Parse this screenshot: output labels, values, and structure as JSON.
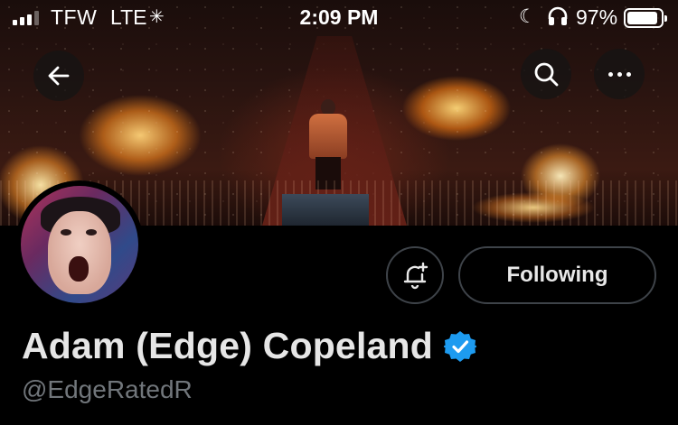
{
  "status_bar": {
    "carrier": "TFW",
    "network": "LTE",
    "time": "2:09 PM",
    "battery_percent": "97%",
    "signal_bars_filled": 3,
    "signal_bars_total": 4,
    "battery_level": 0.97,
    "icons": [
      "signal-icon",
      "activity-spinner-icon",
      "do-not-disturb-moon-icon",
      "headphones-icon",
      "battery-icon"
    ]
  },
  "header": {
    "icons": [
      "back-arrow-icon",
      "search-icon",
      "more-dots-icon"
    ]
  },
  "profile": {
    "display_name": "Adam (Edge) Copeland",
    "handle": "@EdgeRatedR",
    "verified": true
  },
  "actions": {
    "following_label": "Following",
    "notify_icon": "bell-plus-icon"
  },
  "colors": {
    "background": "#000000",
    "verified_badge": "#1d9bf0",
    "handle_text": "#71767b",
    "button_border": "#3e4349"
  }
}
